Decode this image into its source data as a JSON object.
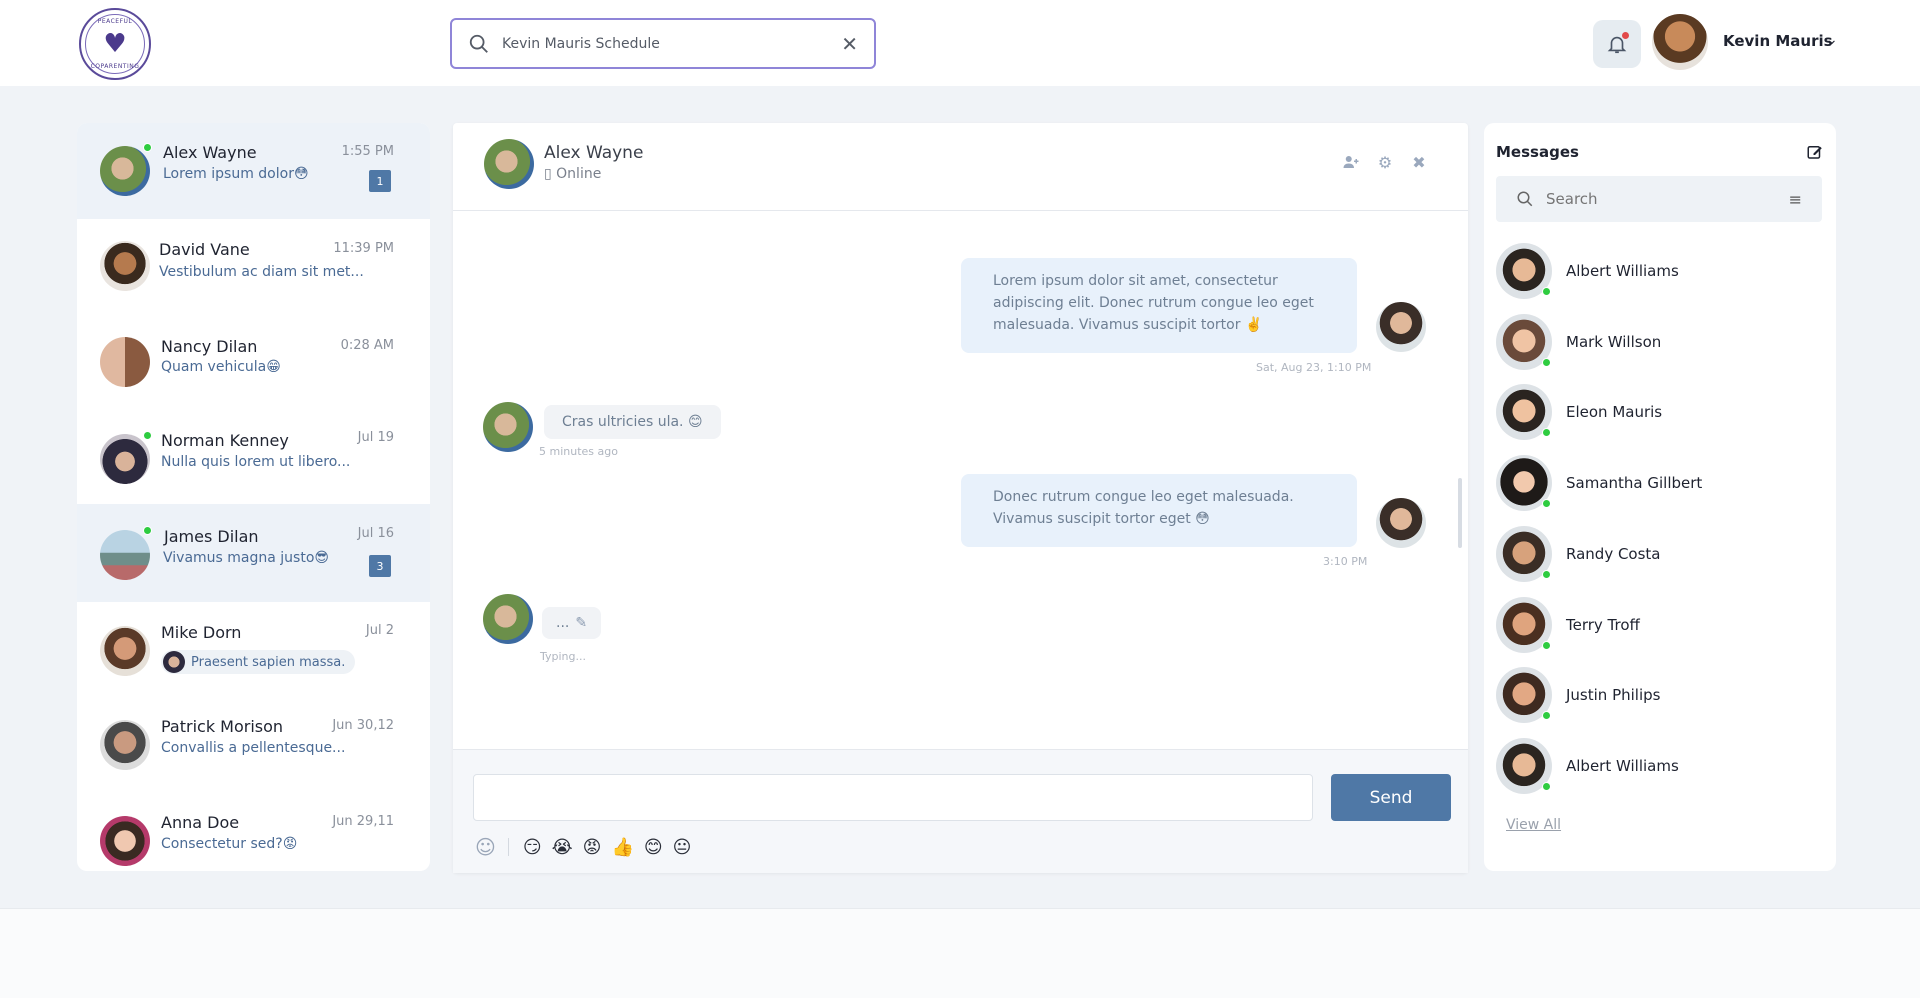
{
  "colors": {
    "accent": "#4f78a6",
    "online": "#2ecc40",
    "search_border": "#8f85d8",
    "active_row": "#edf2f8"
  },
  "logo": {
    "text_top": "PEACEFUL",
    "text_bottom": "COPARENTING"
  },
  "header": {
    "search_value": "Kevin Mauris Schedule",
    "user_name": "Kevin Mauris"
  },
  "conversations": [
    {
      "name": "Alex Wayne",
      "message": "Lorem ipsum dolor😳",
      "time": "1:55 PM",
      "badge": "1"
    },
    {
      "name": "David Vane",
      "message": "Vestibulum ac diam sit met...",
      "time": "11:39 PM"
    },
    {
      "name": "Nancy Dilan",
      "message": "Quam vehicula😁",
      "time": "0:28 AM"
    },
    {
      "name": "Norman Kenney",
      "message": "Nulla quis lorem ut libero...",
      "time": "Jul 19"
    },
    {
      "name": "James Dilan",
      "message": "Vivamus magna justo😎",
      "time": "Jul 16",
      "badge": "3"
    },
    {
      "name": "Mike Dorn",
      "message": "Praesent sapien massa.",
      "time": "Jul 2"
    },
    {
      "name": "Patrick Morison",
      "message": "Convallis a pellentesque...",
      "time": "Jun 30,12"
    },
    {
      "name": "Anna Doe",
      "message": "Consectetur sed?😡",
      "time": "Jun 29,11"
    }
  ],
  "chat": {
    "name": "Alex Wayne",
    "status": "Online",
    "messages": [
      {
        "text": "Lorem ipsum dolor sit amet, consectetur adipiscing elit. Donec rutrum congue leo eget malesuada. Vivamus suscipit tortor ✌️",
        "time": "Sat, Aug 23, 1:10 PM"
      },
      {
        "text": "Cras ultricies ula.  😊",
        "time": "5 minutes ago"
      },
      {
        "text": "Donec rutrum congue leo eget malesuada. Vivamus suscipit tortor eget 😳",
        "time": "3:10 PM"
      },
      {
        "text": "...",
        "time": "Typing..."
      }
    ],
    "composer_placeholder": "",
    "send_label": "Send",
    "emojis": [
      "😏",
      "😭",
      "😡",
      "👍",
      "😊",
      "😐"
    ]
  },
  "right_panel": {
    "title": "Messages",
    "search_placeholder": "Search",
    "contacts": [
      "Albert Williams",
      "Mark Willson",
      "Eleon Mauris",
      "Samantha Gillbert",
      "Randy Costa",
      "Terry Troff",
      "Justin Philips",
      "Albert Williams"
    ],
    "view_all": "View All"
  }
}
